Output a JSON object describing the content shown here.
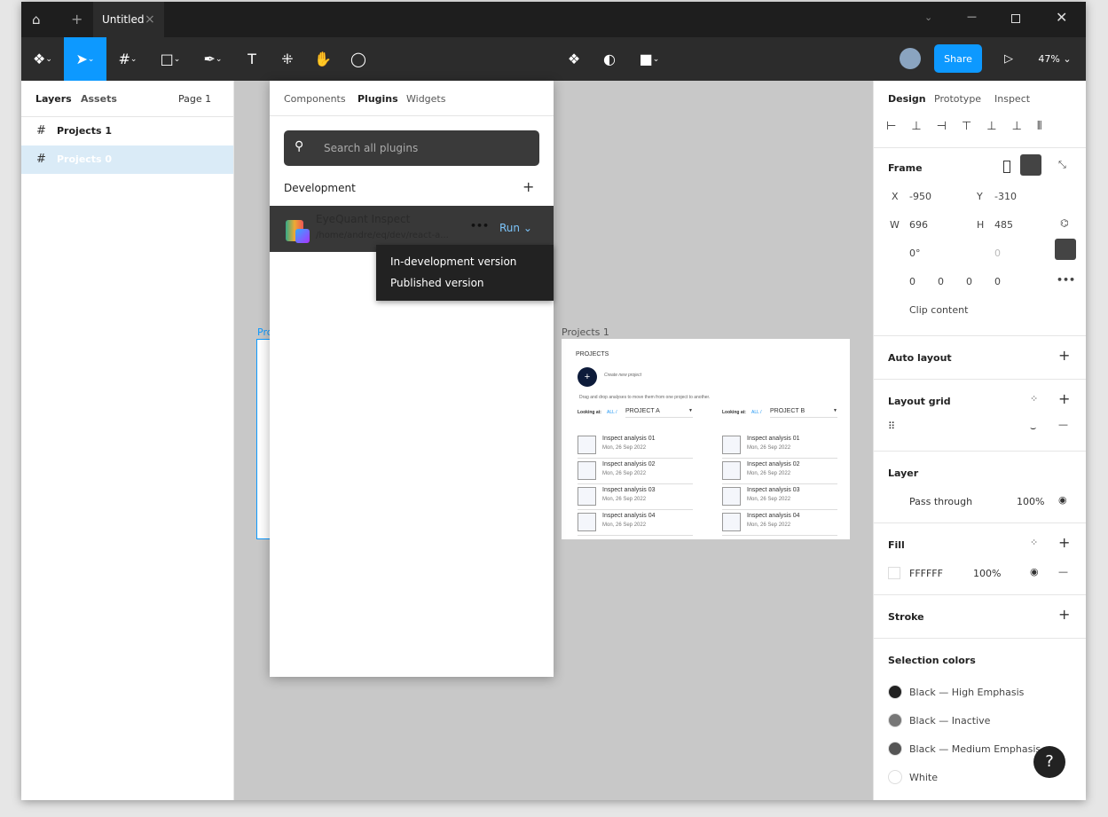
{
  "titlebar": {
    "tab_title": "Untitled",
    "close_tab": "×",
    "new_tab": "+"
  },
  "toolbar": {
    "share": "Share",
    "zoom": "47%"
  },
  "layers": {
    "tabs": [
      "Layers",
      "Assets"
    ],
    "page": "Page 1",
    "items": [
      {
        "label": "Projects 1",
        "selected": false
      },
      {
        "label": "Projects 0",
        "selected": true
      }
    ]
  },
  "plugins": {
    "tabs": [
      "Components",
      "Plugins",
      "Widgets"
    ],
    "active_tab": "Plugins",
    "search_placeholder": "Search all plugins",
    "section": "Development",
    "plugin_name": "EyeQuant Inspect",
    "plugin_path": "/home/andre/eq/dev/react-a...",
    "run": "Run",
    "menu": [
      "In-development version",
      "Published version"
    ]
  },
  "canvas": {
    "frame0_label": "Pro",
    "frame1_label": "Projects 1",
    "frame": {
      "heading": "PROJECTS",
      "create": "Create new project",
      "hint": "Drag and drop analyses to move them from one project to another.",
      "looking_at": "Looking at:",
      "all": "ALL /",
      "columns": [
        {
          "project": "PROJECT A"
        },
        {
          "project": "PROJECT B"
        }
      ],
      "items": [
        {
          "title": "Inspect analysis 01",
          "date": "Mon, 26 Sep 2022"
        },
        {
          "title": "Inspect analysis 02",
          "date": "Mon, 26 Sep 2022"
        },
        {
          "title": "Inspect analysis 03",
          "date": "Mon, 26 Sep 2022"
        },
        {
          "title": "Inspect analysis 04",
          "date": "Mon, 26 Sep 2022"
        }
      ]
    }
  },
  "design": {
    "tabs": [
      "Design",
      "Prototype",
      "Inspect"
    ],
    "frame_title": "Frame",
    "x_label": "X",
    "x": "-950",
    "y_label": "Y",
    "y": "-310",
    "w_label": "W",
    "w": "696",
    "h_label": "H",
    "h": "485",
    "rotation": "0°",
    "radius": "0",
    "corners": [
      "0",
      "0",
      "0",
      "0"
    ],
    "clip": "Clip content",
    "auto_layout": "Auto layout",
    "layout_grid": "Layout grid",
    "layer": "Layer",
    "blend": "Pass through",
    "layer_opacity": "100%",
    "fill": "Fill",
    "fill_hex": "FFFFFF",
    "fill_opacity": "100%",
    "stroke": "Stroke",
    "selection_colors": "Selection colors",
    "colors": [
      {
        "name": "Black — High Emphasis",
        "hex": "#222222"
      },
      {
        "name": "Black — Inactive",
        "hex": "#777777"
      },
      {
        "name": "Black — Medium Emphasis",
        "hex": "#555555"
      },
      {
        "name": "White",
        "hex": "#ffffff"
      }
    ],
    "help": "?"
  },
  "accent": "#0d99ff"
}
